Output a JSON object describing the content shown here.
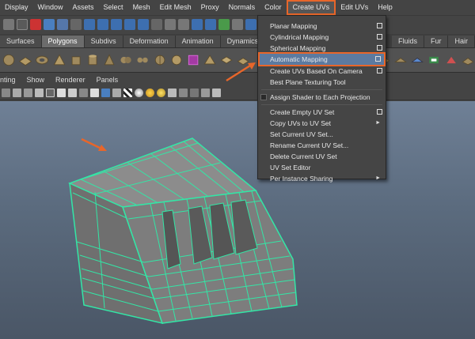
{
  "menubar": {
    "items": [
      "Display",
      "Window",
      "Assets",
      "Select",
      "Mesh",
      "Edit Mesh",
      "Proxy",
      "Normals",
      "Color",
      "Create UVs",
      "Edit UVs",
      "Help"
    ],
    "active_item": "Create UVs",
    "highlight_color": "#e8662a"
  },
  "shelf_tabs": {
    "items": [
      "Surfaces",
      "Polygons",
      "Subdivs",
      "Deformation",
      "Animation",
      "Dynamics",
      "R",
      "Fluids",
      "Fur",
      "Hair"
    ],
    "selected": "Polygons"
  },
  "panel_menu": {
    "items": [
      "nting",
      "Show",
      "Renderer",
      "Panels"
    ]
  },
  "create_uvs_menu": {
    "items": [
      {
        "label": "Planar Mapping",
        "option_box": true
      },
      {
        "label": "Cylindrical Mapping",
        "option_box": true
      },
      {
        "label": "Spherical Mapping",
        "option_box": true
      },
      {
        "label": "Automatic Mapping",
        "option_box": true,
        "highlighted": true
      },
      {
        "label": "Create UVs Based On Camera",
        "option_box": true
      },
      {
        "label": "Best Plane Texturing Tool"
      },
      {
        "label": "Assign Shader to Each Projection",
        "checkbox": true
      },
      {
        "label": "Create Empty UV Set",
        "option_box": true
      },
      {
        "label": "Copy UVs to UV Set",
        "submenu": true
      },
      {
        "label": "Set Current UV Set..."
      },
      {
        "label": "Rename Current UV Set..."
      },
      {
        "label": "Delete Current UV Set"
      },
      {
        "label": "UV Set Editor"
      },
      {
        "label": "Per Instance Sharing",
        "submenu": true
      }
    ],
    "highlight_color": "#5c7aa0"
  },
  "viewport": {
    "mesh_wire_color": "#33e6a6",
    "arrow_color": "#e8662a"
  }
}
